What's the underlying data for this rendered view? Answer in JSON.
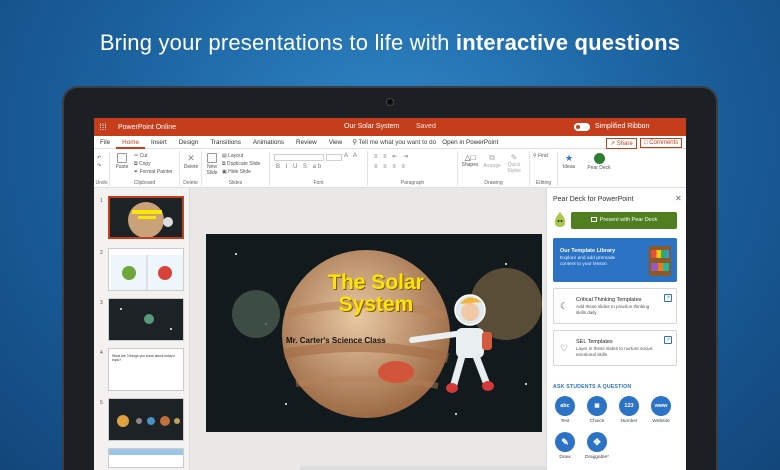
{
  "headline": {
    "normal": "Bring your presentations to life with ",
    "bold": "interactive questions"
  },
  "app": {
    "waffle_icon": "waffle-icon",
    "name": "PowerPoint Online",
    "doc_title": "Our Solar System",
    "save_status": "Saved",
    "simplified_ribbon": "Simplified Ribbon"
  },
  "tabs": [
    "File",
    "Home",
    "Insert",
    "Design",
    "Transitions",
    "Animations",
    "Review",
    "View"
  ],
  "active_tab": "Home",
  "tell_me": "Tell me what you want to do",
  "open_in": "Open in PowerPoint",
  "share": "Share",
  "comments": "Comments",
  "ribbon": {
    "undo": "Undo",
    "paste": "Paste",
    "cut": "Cut",
    "copy": "Copy",
    "format_painter": "Format Painter",
    "clipboard": "Clipboard",
    "delete": "Delete",
    "delete_group": "Delete",
    "new_slide": "New Slide",
    "layout": "Layout",
    "duplicate_slide": "Duplicate Slide",
    "hide_slide": "Hide Slide",
    "slides_group": "Slides",
    "font_group": "Font",
    "paragraph_group": "Paragraph",
    "shapes": "Shapes",
    "arrange": "Arrange",
    "quick_styles": "Quick Styles",
    "drawing_group": "Drawing",
    "find": "Find",
    "editing_group": "Editing",
    "ideas": "Ideas",
    "pear_deck": "Pear Deck"
  },
  "thumbnails": [
    {
      "num": "1",
      "caption": ""
    },
    {
      "num": "2",
      "caption": ""
    },
    {
      "num": "3",
      "caption": ""
    },
    {
      "num": "4",
      "caption": "What are 3 things you know about today's topic?"
    },
    {
      "num": "5",
      "caption": ""
    }
  ],
  "slide": {
    "title": "The Solar System",
    "subtitle": "Mr. Carter's Science Class"
  },
  "pane": {
    "title": "Pear Deck for PowerPoint",
    "present_button": "Present with Pear Deck",
    "library_title": "Our Template Library",
    "library_desc": "Explore and add premade content to your lesson",
    "cards": [
      {
        "title": "Critical Thinking Templates",
        "desc": "Add these slides to practice thinking skills daily",
        "icon": "lightbulb-icon"
      },
      {
        "title": "SEL Templates",
        "desc": "Layer in these slides to nurture social-emotional skills",
        "icon": "heart-icon"
      }
    ],
    "ask_header": "ASK STUDENTS A QUESTION",
    "questions": [
      {
        "glyph": "abc",
        "label": "Text"
      },
      {
        "glyph": "▦",
        "label": "Choice"
      },
      {
        "glyph": "123",
        "label": "Number"
      },
      {
        "glyph": "www",
        "label": "Website"
      },
      {
        "glyph": "✎",
        "label": "Draw"
      },
      {
        "glyph": "✥",
        "label": "Draggable*"
      }
    ]
  },
  "colors": {
    "brand": "#c43e1c",
    "pear_green": "#4f7f1f",
    "pear_blue": "#2c73c6"
  }
}
